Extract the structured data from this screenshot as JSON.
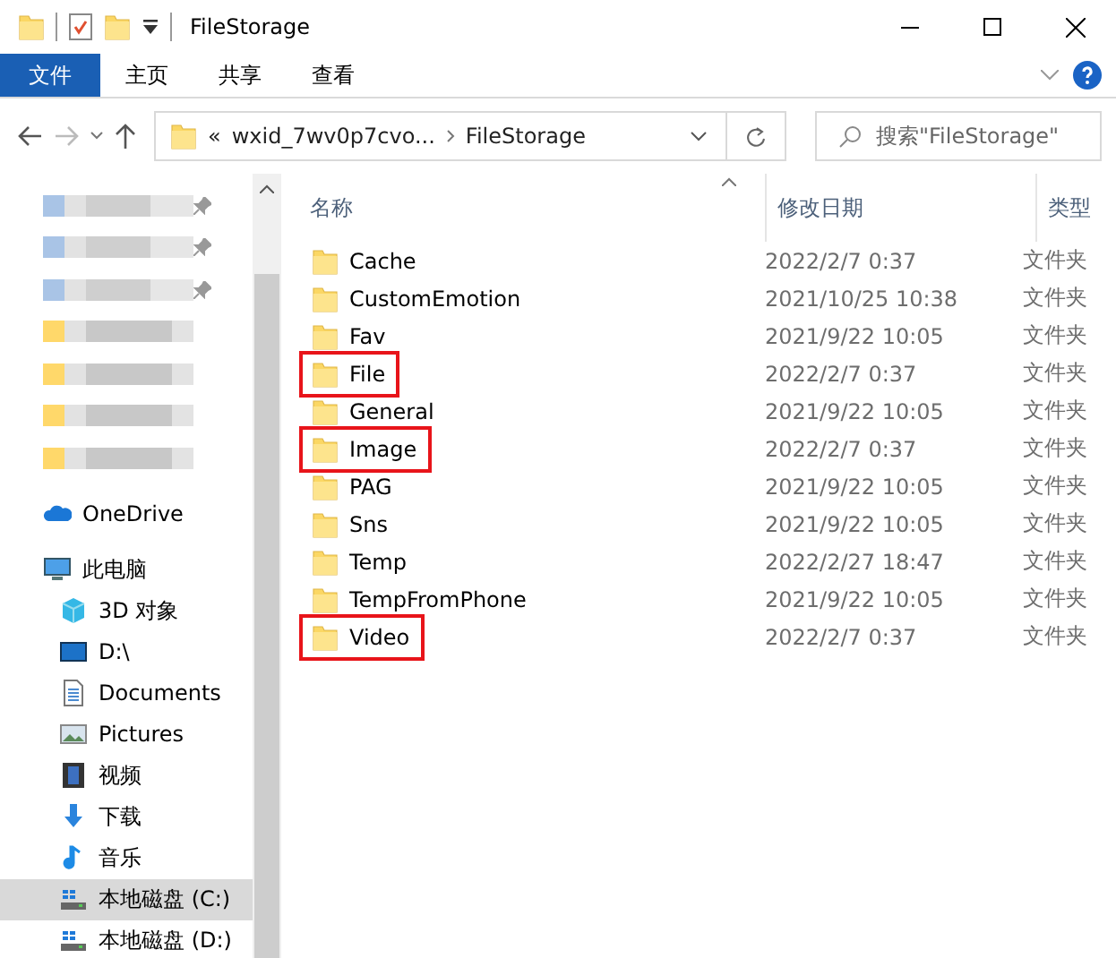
{
  "window": {
    "title": "FileStorage"
  },
  "ribbon_tabs": [
    {
      "label": "文件",
      "selected": true
    },
    {
      "label": "主页",
      "selected": false
    },
    {
      "label": "共享",
      "selected": false
    },
    {
      "label": "查看",
      "selected": false
    }
  ],
  "address": {
    "overflow": "«",
    "crumbs": [
      "wxid_7wv0p7cvo...",
      "FileStorage"
    ]
  },
  "search": {
    "placeholder": "搜索\"FileStorage\""
  },
  "sidebar": {
    "blurred_rows": [
      {
        "kind": "pinned"
      },
      {
        "kind": "pinned"
      },
      {
        "kind": "pinned"
      },
      {
        "kind": "folder"
      },
      {
        "kind": "folder"
      },
      {
        "kind": "folder"
      },
      {
        "kind": "folder"
      }
    ],
    "items": [
      {
        "label": "OneDrive",
        "selected": false
      },
      {
        "label": "此电脑",
        "selected": false,
        "children": [
          {
            "label": "3D 对象",
            "selected": false
          },
          {
            "label": "D:\\",
            "selected": false
          },
          {
            "label": "Documents",
            "selected": false
          },
          {
            "label": "Pictures",
            "selected": false
          },
          {
            "label": "视频",
            "selected": false
          },
          {
            "label": "下载",
            "selected": false
          },
          {
            "label": "音乐",
            "selected": false
          },
          {
            "label": "本地磁盘 (C:)",
            "selected": true
          },
          {
            "label": "本地磁盘 (D:)",
            "selected": false
          }
        ]
      }
    ]
  },
  "table": {
    "columns": [
      "名称",
      "修改日期",
      "类型"
    ],
    "rows": [
      {
        "name": "Cache",
        "date": "2022/2/7 0:37",
        "type": "文件夹",
        "marked": false
      },
      {
        "name": "CustomEmotion",
        "date": "2021/10/25 10:38",
        "type": "文件夹",
        "marked": false
      },
      {
        "name": "Fav",
        "date": "2021/9/22 10:05",
        "type": "文件夹",
        "marked": false
      },
      {
        "name": "File",
        "date": "2022/2/7 0:37",
        "type": "文件夹",
        "marked": true
      },
      {
        "name": "General",
        "date": "2021/9/22 10:05",
        "type": "文件夹",
        "marked": false
      },
      {
        "name": "Image",
        "date": "2022/2/7 0:37",
        "type": "文件夹",
        "marked": true
      },
      {
        "name": "PAG",
        "date": "2021/9/22 10:05",
        "type": "文件夹",
        "marked": false
      },
      {
        "name": "Sns",
        "date": "2021/9/22 10:05",
        "type": "文件夹",
        "marked": false
      },
      {
        "name": "Temp",
        "date": "2022/2/27 18:47",
        "type": "文件夹",
        "marked": false
      },
      {
        "name": "TempFromPhone",
        "date": "2021/9/22 10:05",
        "type": "文件夹",
        "marked": false
      },
      {
        "name": "Video",
        "date": "2022/2/7 0:37",
        "type": "文件夹",
        "marked": true
      }
    ]
  }
}
